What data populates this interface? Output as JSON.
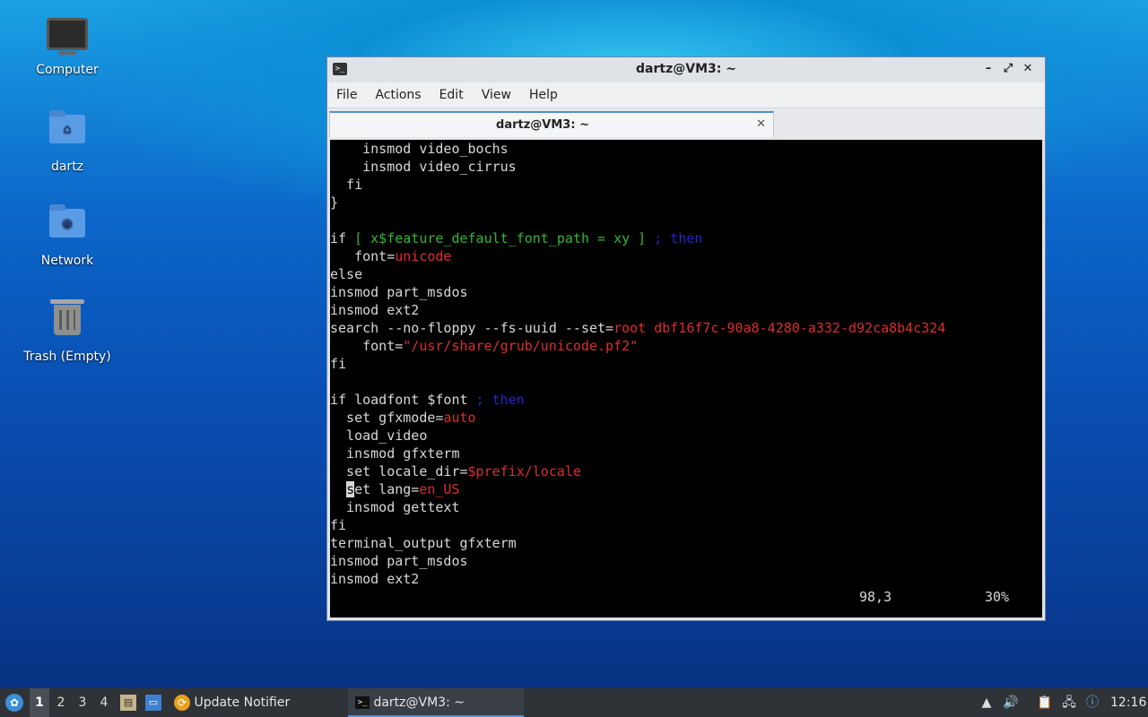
{
  "desktop": {
    "icons": [
      {
        "label": "Computer"
      },
      {
        "label": "dartz"
      },
      {
        "label": "Network"
      },
      {
        "label": "Trash (Empty)"
      }
    ]
  },
  "window": {
    "title": "dartz@VM3: ~",
    "menu": [
      "File",
      "Actions",
      "Edit",
      "View",
      "Help"
    ],
    "tab_title": "dartz@VM3: ~",
    "status_position": "98,3",
    "status_percent": "30%"
  },
  "taskbar": {
    "workspaces": [
      "1",
      "2",
      "3",
      "4"
    ],
    "update_notifier": "Update Notifier",
    "terminal_task": "dartz@VM3: ~",
    "clock": "12:16"
  },
  "colors": {
    "accent": "#4e8fd6",
    "terminal_bg": "#000000",
    "keyword_blue": "#2626c9",
    "string_red": "#d9302c",
    "cond_green": "#33b833"
  }
}
